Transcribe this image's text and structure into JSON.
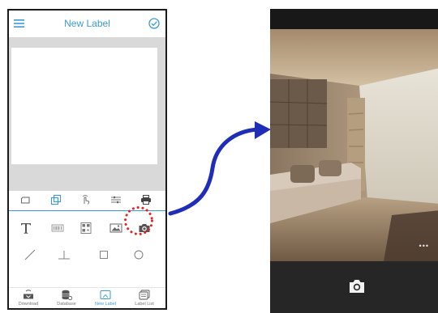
{
  "app": {
    "title": "New Label"
  },
  "icons": {
    "menu": "menu-icon",
    "confirm": "check-circle-icon",
    "camera": "camera-icon",
    "more": "more-dots-icon"
  },
  "toolbar_top": [
    "frame-icon",
    "layers-icon",
    "touch-icon",
    "align-icon",
    "print-icon"
  ],
  "tool_panel": {
    "row1": [
      "text-tool-icon",
      "barcode-tool-icon",
      "qrcode-tool-icon",
      "image-tool-icon",
      "camera-tool-icon"
    ],
    "row2": [
      "line-tool-icon",
      "table-tool-icon",
      "rectangle-tool-icon",
      "circle-tool-icon"
    ],
    "highlighted": "camera-tool-icon"
  },
  "bottom_nav": [
    {
      "label": "Download",
      "icon": "download-icon"
    },
    {
      "label": "Database",
      "icon": "database-icon"
    },
    {
      "label": "New Label",
      "icon": "new-label-icon",
      "active": true
    },
    {
      "label": "Label List",
      "icon": "label-list-icon"
    }
  ],
  "camera_view": {
    "more_label": "•••"
  },
  "colors": {
    "accent": "#3a9ad9",
    "highlight": "#e52222",
    "arrow": "#1f2db8",
    "canvas_bg": "#d9d9d9",
    "camera_bar": "#262626"
  }
}
